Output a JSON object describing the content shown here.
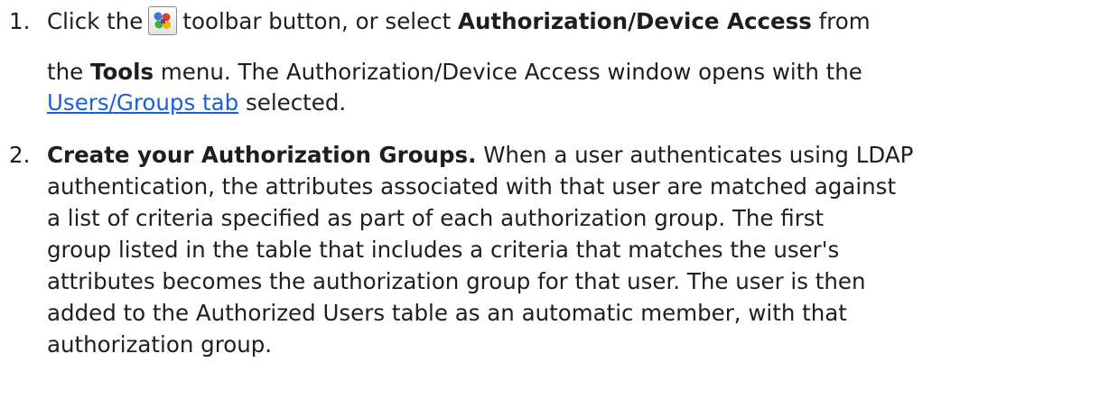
{
  "steps": [
    {
      "number": "1.",
      "text_click": "Click the",
      "toolbar_icon": "authorization-device-access-icon",
      "text_toolbar": "toolbar button, or select",
      "menu_item": "Authorization/Device Access",
      "text_from": "from",
      "text_the": "the",
      "menu_name": "Tools",
      "text_opens": "menu. The Authorization/Device Access window opens with the",
      "link_text": "Users/Groups tab",
      "text_selected": "selected."
    },
    {
      "number": "2.",
      "bold_lead": "Create your Authorization Groups.",
      "line1_rest": "When a user authenticates using LDAP",
      "line2": "authentication, the attributes associated with that user are matched against",
      "line3": "a list of criteria specified as part of each authorization group. The first",
      "line4": "group listed in the table that includes a criteria that matches the user's",
      "line5": "attributes becomes the authorization group for that user. The user is then",
      "line6": "added to the Authorized Users table as an automatic member, with that",
      "line7": "authorization group."
    }
  ]
}
